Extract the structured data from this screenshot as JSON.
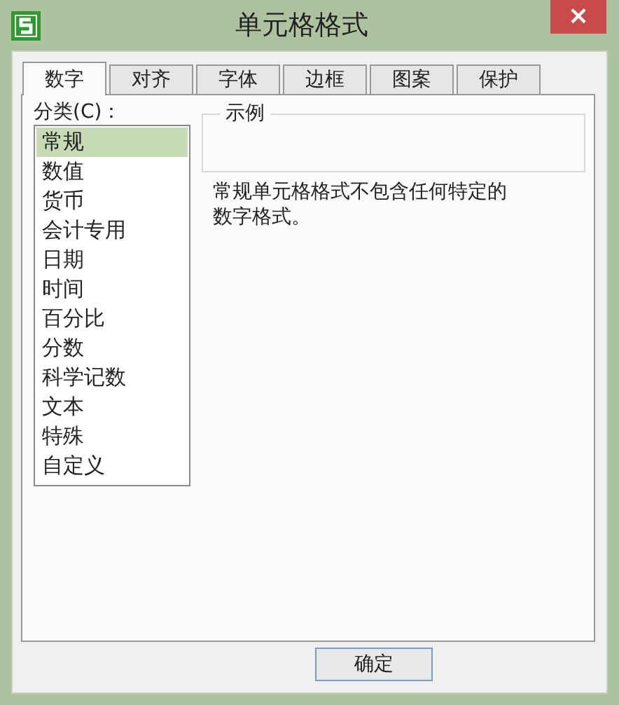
{
  "window": {
    "title": "单元格格式",
    "close": "×"
  },
  "tabs": [
    {
      "label": "数字",
      "selected": true
    },
    {
      "label": "对齐",
      "selected": false
    },
    {
      "label": "字体",
      "selected": false
    },
    {
      "label": "边框",
      "selected": false
    },
    {
      "label": "图案",
      "selected": false
    },
    {
      "label": "保护",
      "selected": false
    }
  ],
  "category": {
    "label": "分类(C)：",
    "items": [
      {
        "label": "常规",
        "selected": true
      },
      {
        "label": "数值",
        "selected": false
      },
      {
        "label": "货币",
        "selected": false
      },
      {
        "label": "会计专用",
        "selected": false
      },
      {
        "label": "日期",
        "selected": false
      },
      {
        "label": "时间",
        "selected": false
      },
      {
        "label": "百分比",
        "selected": false
      },
      {
        "label": "分数",
        "selected": false
      },
      {
        "label": "科学记数",
        "selected": false
      },
      {
        "label": "文本",
        "selected": false
      },
      {
        "label": "特殊",
        "selected": false
      },
      {
        "label": "自定义",
        "selected": false
      }
    ]
  },
  "sample": {
    "label": "示例"
  },
  "description": "常规单元格格式不包含任何特定的数字格式。",
  "buttons": [
    {
      "label": "确定"
    }
  ]
}
